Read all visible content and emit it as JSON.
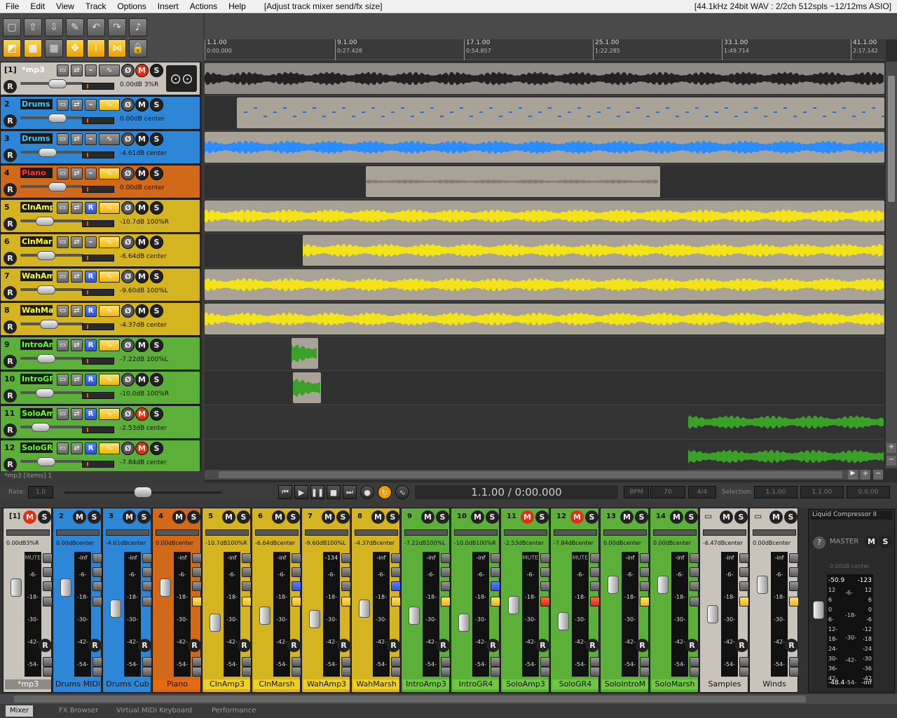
{
  "menubar": {
    "items": [
      "File",
      "Edit",
      "View",
      "Track",
      "Options",
      "Insert",
      "Actions",
      "Help"
    ],
    "status": "[Adjust track mixer send/fx size]",
    "audio": "[44.1kHz 24bit WAV : 2/2ch 512spls ~12/12ms ASIO]"
  },
  "ruler": {
    "marks": [
      {
        "bar": "1.1.00",
        "time": "0:00.000"
      },
      {
        "bar": "9.1.00",
        "time": "0:27.428"
      },
      {
        "bar": "17.1.00",
        "time": "0:54.857"
      },
      {
        "bar": "25.1.00",
        "time": "1:22.285"
      },
      {
        "bar": "33.1.00",
        "time": "1:49.714"
      },
      {
        "bar": "41.1.00",
        "time": "2:17.142"
      }
    ]
  },
  "tracks": [
    {
      "num": "[1]",
      "name": "*mp3",
      "info": "0.00dB 3%R",
      "color": "#c8c3bb"
    },
    {
      "num": "2",
      "name": "Drums M",
      "info": "0.00dB center",
      "color": "#2e86d6"
    },
    {
      "num": "3",
      "name": "Drums C",
      "info": "-4.61dB center",
      "color": "#2e86d6"
    },
    {
      "num": "4",
      "name": "Piano",
      "info": "0.00dB center",
      "color": "#d06a1a"
    },
    {
      "num": "5",
      "name": "ClnAmp",
      "info": "-10.7dB 100%R",
      "color": "#d4b421"
    },
    {
      "num": "6",
      "name": "ClnMars",
      "info": "-6.64dB center",
      "color": "#d4b421"
    },
    {
      "num": "7",
      "name": "WahAmp",
      "info": "-9.60dB 100%L",
      "color": "#d4b421"
    },
    {
      "num": "8",
      "name": "WahMar",
      "info": "-4.37dB center",
      "color": "#d4b421"
    },
    {
      "num": "9",
      "name": "IntroAm",
      "info": "-7.22dB 100%L",
      "color": "#5cb03a"
    },
    {
      "num": "10",
      "name": "IntroGR",
      "info": "-10.0dB 100%R",
      "color": "#5cb03a"
    },
    {
      "num": "11",
      "name": "SoloAm",
      "info": "-2.53dB center",
      "color": "#5cb03a"
    },
    {
      "num": "12",
      "name": "SoloGR",
      "info": "-7.84dB center",
      "color": "#5cb03a"
    }
  ],
  "statusline": "*mp3 [items] 1",
  "transport": {
    "rate_label": "Rate:",
    "rate": "1.0",
    "time": "1.1.00 / 0:00.000",
    "bpm_label": "BPM",
    "bpm": "70",
    "sig": "4/4",
    "sel_label": "Selection:",
    "sel_start": "1.1.00",
    "sel_end": "1.1.00",
    "sel_len": "0.0.00"
  },
  "mixer": {
    "strips": [
      {
        "num": "[1]",
        "name": "*mp3",
        "info": "0.00dB3%R",
        "color": "#c8c3bb",
        "peak": "MUTE",
        "mred": true
      },
      {
        "num": "2",
        "name": "Drums MIDI",
        "info": "0.00dBcenter",
        "color": "#2e86d6",
        "peak": "-inf",
        "mred": false
      },
      {
        "num": "3",
        "name": "Drums Cub",
        "info": "-4.61dBcenter",
        "color": "#2e86d6",
        "peak": "-inf",
        "mred": false
      },
      {
        "num": "4",
        "name": "Piano",
        "info": "0.00dBcenter",
        "color": "#d06a1a",
        "peak": "-inf",
        "mred": false
      },
      {
        "num": "5",
        "name": "ClnAmp3",
        "info": "-10.7dB100%R",
        "color": "#d4b421",
        "peak": "-inf",
        "mred": false
      },
      {
        "num": "6",
        "name": "ClnMarsh",
        "info": "-6.64dBcenter",
        "color": "#d4b421",
        "peak": "-inf",
        "mred": false
      },
      {
        "num": "7",
        "name": "WahAmp3",
        "info": "-9.60dB100%L",
        "color": "#d4b421",
        "peak": "-134",
        "mred": false
      },
      {
        "num": "8",
        "name": "WahMarsh",
        "info": "-4.37dBcenter",
        "color": "#d4b421",
        "peak": "-inf",
        "mred": false
      },
      {
        "num": "9",
        "name": "IntroAmp3",
        "info": "-7.22dB100%L",
        "color": "#5cb03a",
        "peak": "-inf",
        "mred": false
      },
      {
        "num": "10",
        "name": "IntroGR4",
        "info": "-10.0dB100%R",
        "color": "#5cb03a",
        "peak": "-inf",
        "mred": false
      },
      {
        "num": "11",
        "name": "SoloAmp3",
        "info": "-2.53dBcenter",
        "color": "#5cb03a",
        "peak": "MUTE",
        "mred": true
      },
      {
        "num": "12",
        "name": "SoloGR4",
        "info": "-7.84dBcenter",
        "color": "#5cb03a",
        "peak": "MUTE",
        "mred": true
      },
      {
        "num": "13",
        "name": "SoloIntroM",
        "info": "0.00dBcenter",
        "color": "#5cb03a",
        "peak": "-inf",
        "mred": false
      },
      {
        "num": "14",
        "name": "SoloMarsh",
        "info": "0.00dBcenter",
        "color": "#5cb03a",
        "peak": "-inf",
        "mred": false
      },
      {
        "num": "",
        "name": "Samples",
        "info": "-6.47dBcenter",
        "color": "#c8c3bb",
        "peak": "-inf",
        "mred": false
      },
      {
        "num": "",
        "name": "Winds",
        "info": "0.00dBcenter",
        "color": "#c8c3bb",
        "peak": "-inf",
        "mred": false
      }
    ],
    "scale": [
      "-6-",
      "-18-",
      "-30-",
      "-42-",
      "-54-"
    ],
    "master": {
      "fx": "Liquid Compressor II",
      "label": "MASTER",
      "info": "0.00dB center",
      "peak_l": "-50.9",
      "peak_r": "-123",
      "bottom_l": "-48.4",
      "bottom_r": "-inf",
      "scale": [
        "12",
        "6",
        "0",
        "6-",
        "12-",
        "18-",
        "24-",
        "30-",
        "36-",
        "42-"
      ],
      "scale_r": [
        "12",
        "6",
        "0",
        "-6",
        "-12",
        "-18",
        "-24",
        "-30",
        "-36",
        "-42"
      ],
      "mid": [
        "-6-",
        "-18-",
        "-30-",
        "-42-",
        "-54-"
      ]
    }
  },
  "tabs": [
    "Mixer",
    "FX Browser",
    "Virtual MIDI Keyboard",
    "Performance"
  ]
}
